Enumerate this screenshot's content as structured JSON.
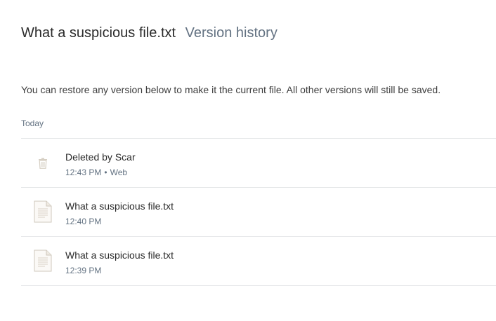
{
  "header": {
    "filename": "What a suspicious file.txt",
    "subtitle": "Version history"
  },
  "description": "You can restore any version below to make it the current file. All other versions will still be saved.",
  "groups": [
    {
      "label": "Today",
      "versions": [
        {
          "icon": "trash-icon",
          "title": "Deleted by Scar",
          "time": "12:43 PM",
          "separator": "•",
          "source": "Web"
        },
        {
          "icon": "text-file-icon",
          "title": "What a suspicious file.txt",
          "time": "12:40 PM"
        },
        {
          "icon": "text-file-icon",
          "title": "What a suspicious file.txt",
          "time": "12:39 PM"
        }
      ]
    }
  ],
  "colors": {
    "muted": "#637282",
    "divider": "#e6e8ea",
    "icon": "#c9c2b6"
  }
}
